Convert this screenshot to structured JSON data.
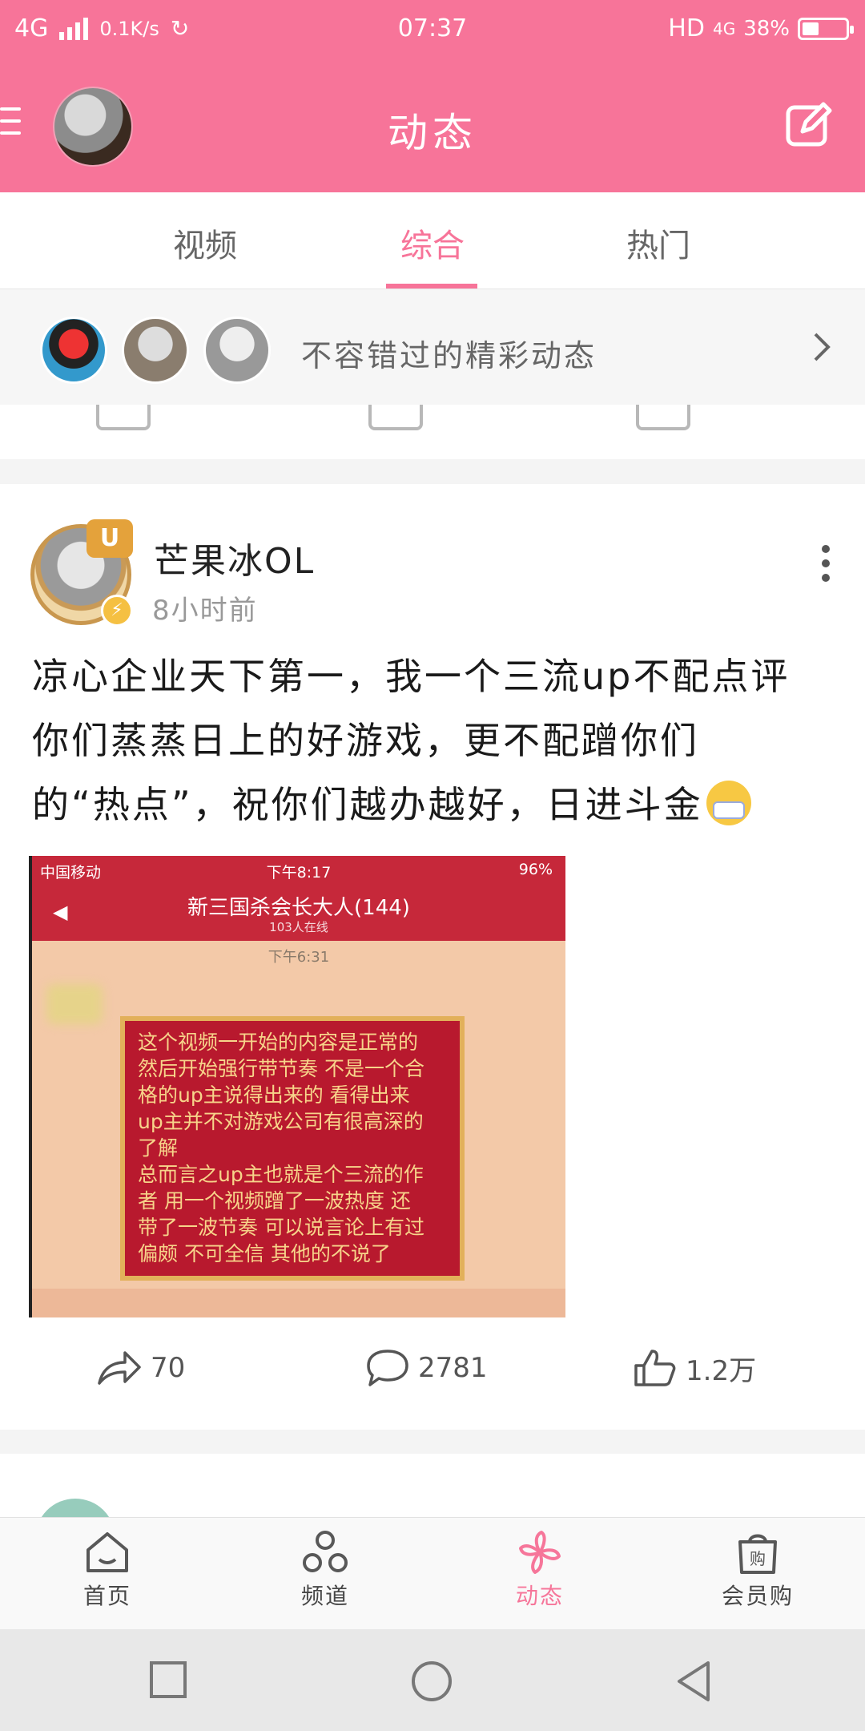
{
  "status_bar": {
    "network": "4G",
    "speed": "0.1K/s",
    "time": "07:37",
    "hd": "HD",
    "network_right": "4G",
    "battery": "38%"
  },
  "header": {
    "title": "动态",
    "accent_color": "#f77499"
  },
  "tabs": {
    "items": [
      "视频",
      "综合",
      "热门"
    ],
    "active": "综合"
  },
  "banner": {
    "text": "不容错过的精彩动态"
  },
  "post": {
    "author": "芒果冰OL",
    "time": "8小时前",
    "badge": "U",
    "text_lines": [
      "凉心企业天下第一，我一个三流up不配点评",
      "你们蒸蒸日上的好游戏，更不配蹭你们",
      "的“热点”，祝你们越办越好，日进斗金"
    ],
    "image": {
      "carrier": "中国移动",
      "time": "下午8:17",
      "battery": "96%",
      "group_title": "新三国杀会长大人(144)",
      "online": "103人在线",
      "msg_time": "下午6:31",
      "bubble_lines": [
        "这个视频一开始的内容是正常的",
        "然后开始强行带节奏 不是一个合",
        "格的up主说得出来的 看得出来",
        "up主并不对游戏公司有很高深的",
        "了解",
        "总而言之up主也就是个三流的作",
        "者 用一个视频蹭了一波热度 还",
        "带了一波节奏 可以说言论上有过",
        "偏颇 不可全信 其他的不说了"
      ]
    },
    "shares": "70",
    "comments": "2781",
    "likes": "1.2万"
  },
  "bottom_nav": {
    "items": [
      "首页",
      "频道",
      "动态",
      "会员购"
    ],
    "active": "动态"
  }
}
